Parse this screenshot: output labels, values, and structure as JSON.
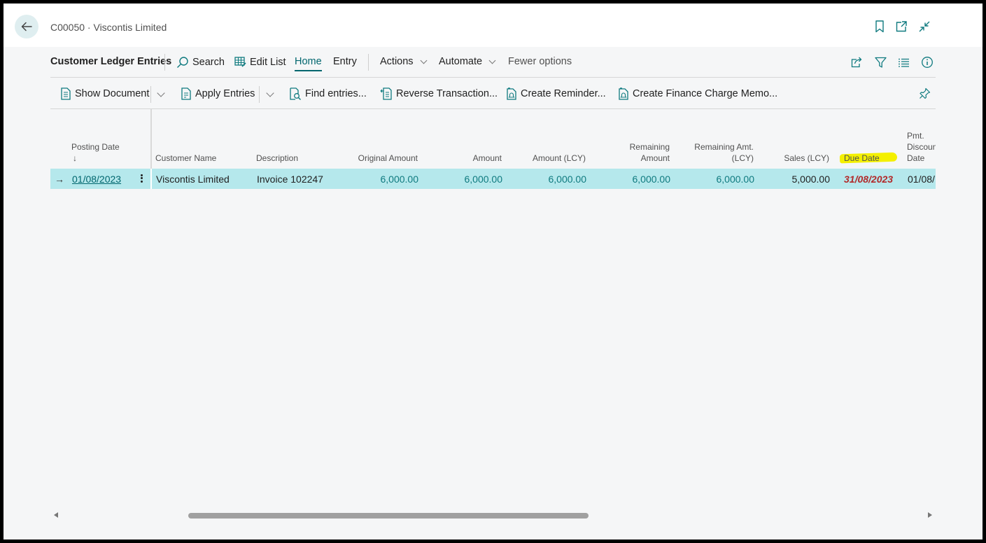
{
  "window": {
    "breadcrumb": "C00050 · Viscontis Limited"
  },
  "action_bar": {
    "page_title": "Customer Ledger Entries",
    "search": "Search",
    "edit_list": "Edit List",
    "home": "Home",
    "entry": "Entry",
    "actions": "Actions",
    "automate": "Automate",
    "fewer_options": "Fewer options"
  },
  "promoted_actions": {
    "show_document": "Show Document",
    "apply_entries": "Apply Entries",
    "find_entries": "Find entries...",
    "reverse_transaction": "Reverse Transaction...",
    "create_reminder": "Create Reminder...",
    "create_finance_charge_memo": "Create Finance Charge Memo..."
  },
  "grid": {
    "columns": {
      "posting_date": "Posting Date",
      "sort_indicator": "↓",
      "customer_name": "Customer Name",
      "description": "Description",
      "original_amount": "Original Amount",
      "amount": "Amount",
      "amount_lcy": "Amount (LCY)",
      "remaining_amount_1": "Remaining",
      "remaining_amount_2": "Amount",
      "remaining_amt_lcy_1": "Remaining Amt.",
      "remaining_amt_lcy_2": "(LCY)",
      "sales_lcy": "Sales (LCY)",
      "due_date": "Due Date",
      "pmt_discount_date_1": "Pmt.",
      "pmt_discount_date_2": "Discoun",
      "pmt_discount_date_3": "Date"
    },
    "rows": [
      {
        "posting_date": "01/08/2023",
        "customer_name": "Viscontis Limited",
        "description": "Invoice 102247",
        "original_amount": "6,000.00",
        "amount": "6,000.00",
        "amount_lcy": "6,000.00",
        "remaining_amount": "6,000.00",
        "remaining_amt_lcy": "6,000.00",
        "sales_lcy": "5,000.00",
        "due_date": "31/08/2023",
        "pmt_discount_date": "01/08/"
      }
    ]
  },
  "colors": {
    "accent": "#00666e",
    "selected_row": "#b5e8ec",
    "overdue": "#b22a2a",
    "highlight": "#f4f000",
    "amount_text": "#0f7a7f"
  }
}
